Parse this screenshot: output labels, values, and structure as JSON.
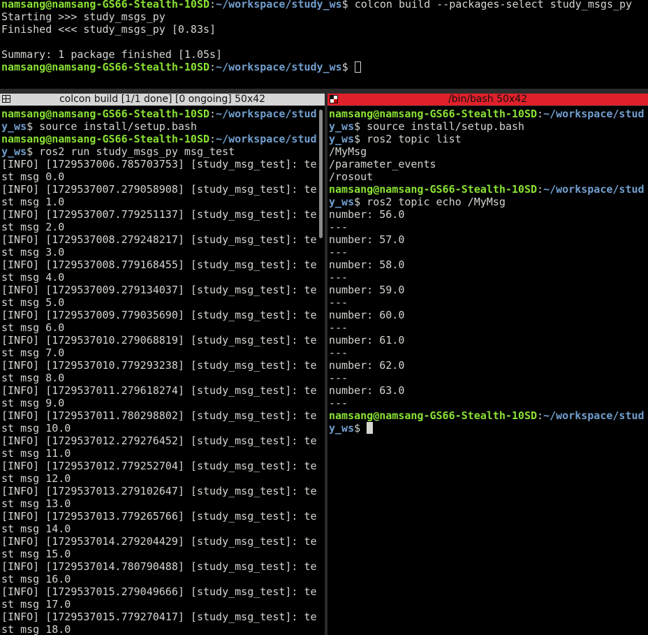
{
  "prompt": {
    "user_host": "namsang@namsang-GS66-Stealth-10SD",
    "colon": ":",
    "path": "~/workspace/study_ws",
    "dollar": "$"
  },
  "top_pane": {
    "command": " colcon build --packages-select study_msgs_py",
    "output": [
      "Starting >>> study_msgs_py",
      "Finished <<< study_msgs_py [0.83s]",
      "",
      "Summary: 1 package finished [1.05s]"
    ]
  },
  "left_pane": {
    "title": "colcon build [1/1 done] [0 ongoing] 50x42",
    "prompt_wrap_a": "namsang@namsang-GS66-Stealth-10SD",
    "prompt_wrap_path_a": "~/workspace/stud",
    "prompt_wrap_path_b": "y_ws",
    "cmd_source": " source install/setup.bash",
    "cmd_run": " ros2 run study_msgs_py msg_test",
    "log_lines": [
      "[INFO] [1729537006.785703753] [study_msg_test]: te",
      "st msg 0.0",
      "[INFO] [1729537007.279058908] [study_msg_test]: te",
      "st msg 1.0",
      "[INFO] [1729537007.779251137] [study_msg_test]: te",
      "st msg 2.0",
      "[INFO] [1729537008.279248217] [study_msg_test]: te",
      "st msg 3.0",
      "[INFO] [1729537008.779168455] [study_msg_test]: te",
      "st msg 4.0",
      "[INFO] [1729537009.279134037] [study_msg_test]: te",
      "st msg 5.0",
      "[INFO] [1729537009.779035690] [study_msg_test]: te",
      "st msg 6.0",
      "[INFO] [1729537010.279068819] [study_msg_test]: te",
      "st msg 7.0",
      "[INFO] [1729537010.779293238] [study_msg_test]: te",
      "st msg 8.0",
      "[INFO] [1729537011.279618274] [study_msg_test]: te",
      "st msg 9.0",
      "[INFO] [1729537011.780298802] [study_msg_test]: te",
      "st msg 10.0",
      "[INFO] [1729537012.279276452] [study_msg_test]: te",
      "st msg 11.0",
      "[INFO] [1729537012.779252704] [study_msg_test]: te",
      "st msg 12.0",
      "[INFO] [1729537013.279102647] [study_msg_test]: te",
      "st msg 13.0",
      "[INFO] [1729537013.779265766] [study_msg_test]: te",
      "st msg 14.0",
      "[INFO] [1729537014.279204429] [study_msg_test]: te",
      "st msg 15.0",
      "[INFO] [1729537014.780790488] [study_msg_test]: te",
      "st msg 16.0",
      "[INFO] [1729537015.279049666] [study_msg_test]: te",
      "st msg 17.0",
      "[INFO] [1729537015.779270417] [study_msg_test]: te",
      "st msg 18.0"
    ]
  },
  "right_pane": {
    "title": "/bin/bash 50x42",
    "cmd_source": " source install/setup.bash",
    "cmd_list": " ros2 topic list",
    "topics": [
      "/MyMsg",
      "/parameter_events",
      "/rosout"
    ],
    "cmd_echo": " ros2 topic echo /MyMsg",
    "echo_lines": [
      "number: 56.0",
      "---",
      "number: 57.0",
      "---",
      "number: 58.0",
      "---",
      "number: 59.0",
      "---",
      "number: 60.0",
      "---",
      "number: 61.0",
      "---",
      "number: 62.0",
      "---",
      "number: 63.0",
      "---"
    ]
  },
  "icons": {
    "left_title_icon": "split-pane-icon",
    "right_title_icon": "terminal-grid-icon"
  },
  "colors": {
    "prompt_user": "#8ae234",
    "prompt_path": "#729fcf",
    "active_title": "#e0202a",
    "inactive_title": "#d6d6d6"
  }
}
